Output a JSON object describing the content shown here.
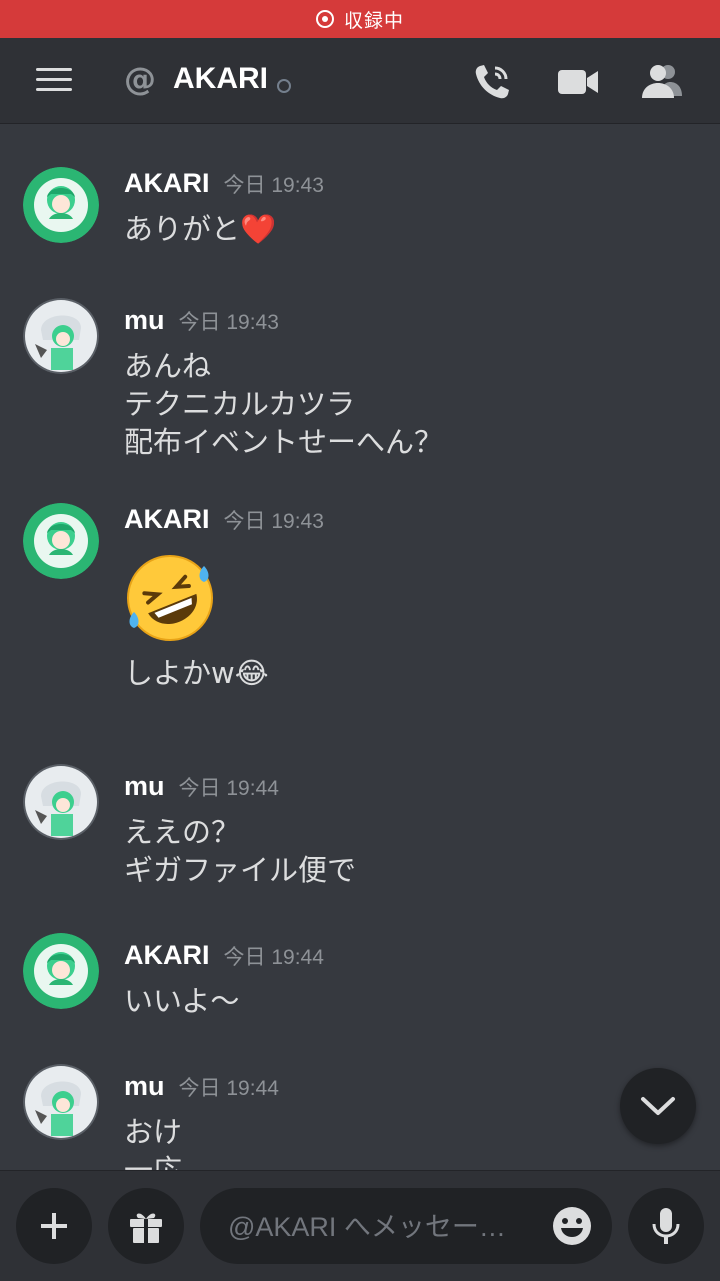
{
  "recording": {
    "label": "収録中"
  },
  "header": {
    "channel_name": "AKARI",
    "at_symbol": "@"
  },
  "messages": [
    {
      "author": "AKARI",
      "timestamp": "今日 19:43",
      "text": "ありがと❤️"
    },
    {
      "author": "mu",
      "timestamp": "今日 19:43",
      "lines": [
        "あんね",
        "テクニカルカツラ",
        "配布イベントせーへん？"
      ]
    },
    {
      "author": "AKARI",
      "timestamp": "今日 19:43",
      "big_emoji": "rolling-on-floor-laughing",
      "text": "しよかw😂"
    },
    {
      "author": "mu",
      "timestamp": "今日 19:44",
      "lines": [
        "ええの？",
        "ギガファイル便で"
      ]
    },
    {
      "author": "AKARI",
      "timestamp": "今日 19:44",
      "text": "いいよ〜"
    },
    {
      "author": "mu",
      "timestamp": "今日 19:44",
      "lines": [
        "おけ",
        "一応"
      ]
    }
  ],
  "composer": {
    "placeholder": "@AKARI へメッセー…"
  },
  "colors": {
    "background": "#36393f",
    "header": "#2f3136",
    "recording": "#d53a3a",
    "avatar_green": "#2bb673"
  }
}
